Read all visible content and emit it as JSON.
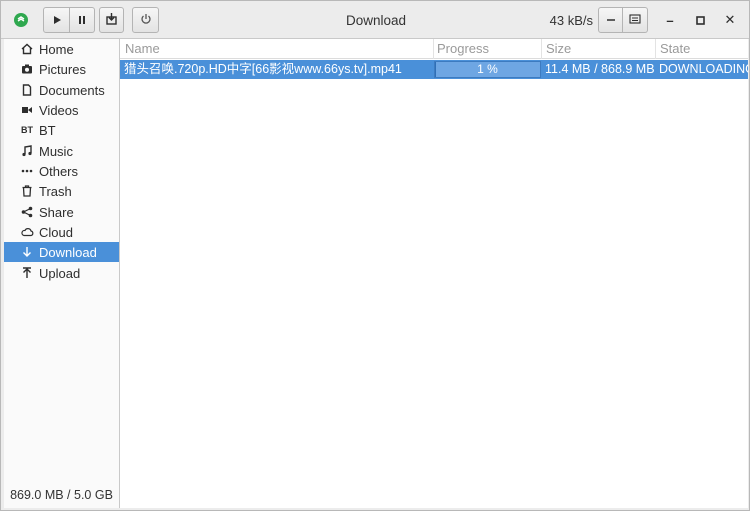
{
  "header": {
    "title": "Download",
    "speed": "43 kB/s",
    "toolbar": {
      "start_icon": "play-icon",
      "pause_icon": "pause-icon",
      "clear_icon": "trash-download-icon",
      "power_icon": "power-icon",
      "minimize_speed_icon": "minus-icon",
      "menu_icon": "menu-icon"
    },
    "window_controls": {
      "minimize": "–",
      "maximize": "□",
      "close": "✕"
    }
  },
  "sidebar": {
    "items": [
      {
        "label": "Home",
        "icon": "home-icon",
        "glyph": "⌂"
      },
      {
        "label": "Pictures",
        "icon": "camera-icon",
        "glyph": "◙"
      },
      {
        "label": "Documents",
        "icon": "document-icon",
        "glyph": "▯"
      },
      {
        "label": "Videos",
        "icon": "video-icon",
        "glyph": "▶"
      },
      {
        "label": "BT",
        "icon": "bt-icon",
        "glyph": "BT"
      },
      {
        "label": "Music",
        "icon": "music-icon",
        "glyph": "♫"
      },
      {
        "label": "Others",
        "icon": "more-icon",
        "glyph": "•••"
      },
      {
        "label": "Trash",
        "icon": "trash-icon",
        "glyph": "🗑"
      },
      {
        "label": "Share",
        "icon": "share-icon",
        "glyph": "<"
      },
      {
        "label": "Cloud",
        "icon": "cloud-icon",
        "glyph": "☁"
      },
      {
        "label": "Download",
        "icon": "download-icon",
        "glyph": "↓",
        "active": true
      },
      {
        "label": "Upload",
        "icon": "upload-icon",
        "glyph": "↑"
      }
    ],
    "storage": "869.0 MB / 5.0 GB"
  },
  "list": {
    "columns": [
      "Name",
      "Progress",
      "Size",
      "State"
    ],
    "rows": [
      {
        "name": "猎头召唤.720p.HD中字[66影视www.66ys.tv].mp41",
        "progress_text": "1 %",
        "progress_value": 0.01,
        "size": "11.4 MB / 868.9 MB",
        "state": "DOWNLOADING"
      }
    ]
  },
  "colors": {
    "accent": "#4a90d9",
    "app_icon": "#2fa84f"
  }
}
